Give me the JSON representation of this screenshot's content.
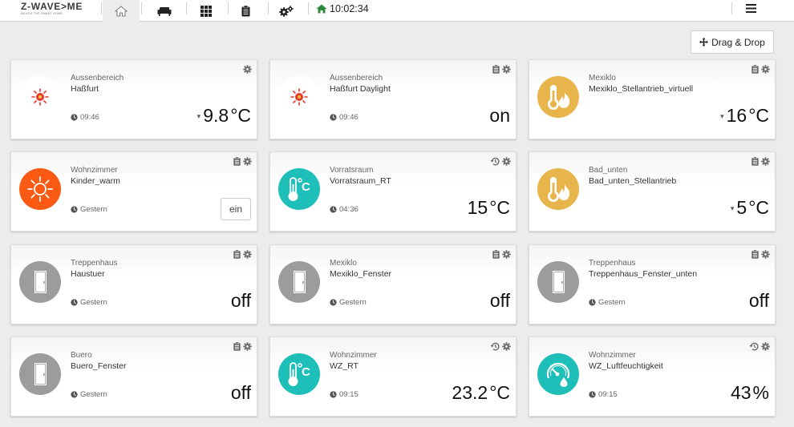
{
  "header": {
    "logo": "Z-WAVE>ME",
    "logo_sub": "BUILDS THE SMART HOME",
    "nav": [
      {
        "icon": "home-icon",
        "active": true
      },
      {
        "icon": "sofa-icon",
        "active": false
      },
      {
        "icon": "grid-icon",
        "active": false
      },
      {
        "icon": "clipboard-icon",
        "active": false
      },
      {
        "icon": "gears-icon",
        "active": false
      }
    ],
    "clock": "10:02:34",
    "clock_icon": "home-icon",
    "menu_icon": "hamburger-icon"
  },
  "toolbar": {
    "drag_drop_label": "Drag & Drop"
  },
  "colors": {
    "sun": "#e8392a",
    "orange": "#fa5a14",
    "gold": "#e8b54c",
    "teal": "#1ebeb9",
    "gray": "#9c9c9c"
  },
  "cards": [
    {
      "location": "Aussenbereich",
      "name": "Haßfurt",
      "time": "09:46",
      "icon": "sun-small-icon",
      "actions": [
        "settings"
      ],
      "value": "9.8",
      "unit": "°C",
      "trend": "▾"
    },
    {
      "location": "Aussenbereich",
      "name": "Haßfurt Daylight",
      "time": "09:46",
      "icon": "sun-small-icon",
      "actions": [
        "history",
        "settings"
      ],
      "value": "on",
      "unit": ""
    },
    {
      "location": "Mexiklo",
      "name": "Mexiklo_Stellantrieb_virtuell",
      "time": "",
      "icon": "thermostat-flame-icon",
      "actions": [
        "history",
        "settings"
      ],
      "value": "16",
      "unit": "°C",
      "trend": "▾"
    },
    {
      "location": "Wohnzimmer",
      "name": "Kinder_warm",
      "time": "Gestern",
      "icon": "sun-outline-icon",
      "actions": [
        "history",
        "settings"
      ],
      "button": "ein"
    },
    {
      "location": "Vorratsraum",
      "name": "Vorratsraum_RT",
      "time": "04:36",
      "icon": "thermometer-celsius-icon",
      "actions": [
        "chart",
        "settings"
      ],
      "value": "15",
      "unit": "°C"
    },
    {
      "location": "Bad_unten",
      "name": "Bad_unten_Stellantrieb",
      "time": "",
      "icon": "thermostat-flame-icon",
      "actions": [
        "history",
        "settings"
      ],
      "value": "5",
      "unit": "°C",
      "trend": "▾"
    },
    {
      "location": "Treppenhaus",
      "name": "Haustuer",
      "time": "Gestern",
      "icon": "door-icon",
      "actions": [
        "history",
        "settings"
      ],
      "value": "off",
      "unit": ""
    },
    {
      "location": "Mexiklo",
      "name": "Mexiklo_Fenster",
      "time": "Gestern",
      "icon": "door-icon",
      "actions": [
        "history",
        "settings"
      ],
      "value": "off",
      "unit": ""
    },
    {
      "location": "Treppenhaus",
      "name": "Treppenhaus_Fenster_unten",
      "time": "Gestern",
      "icon": "door-icon",
      "actions": [
        "history",
        "settings"
      ],
      "value": "off",
      "unit": ""
    },
    {
      "location": "Buero",
      "name": "Buero_Fenster",
      "time": "Gestern",
      "icon": "door-icon",
      "actions": [
        "history",
        "settings"
      ],
      "value": "off",
      "unit": ""
    },
    {
      "location": "Wohnzimmer",
      "name": "WZ_RT",
      "time": "09:15",
      "icon": "thermometer-celsius-icon",
      "actions": [
        "chart",
        "settings"
      ],
      "value": "23.2",
      "unit": "°C"
    },
    {
      "location": "Wohnzimmer",
      "name": "WZ_Luftfeuchtigkeit",
      "time": "09:15",
      "icon": "humidity-gauge-icon",
      "actions": [
        "chart",
        "settings"
      ],
      "value": "43",
      "unit": "%"
    }
  ]
}
